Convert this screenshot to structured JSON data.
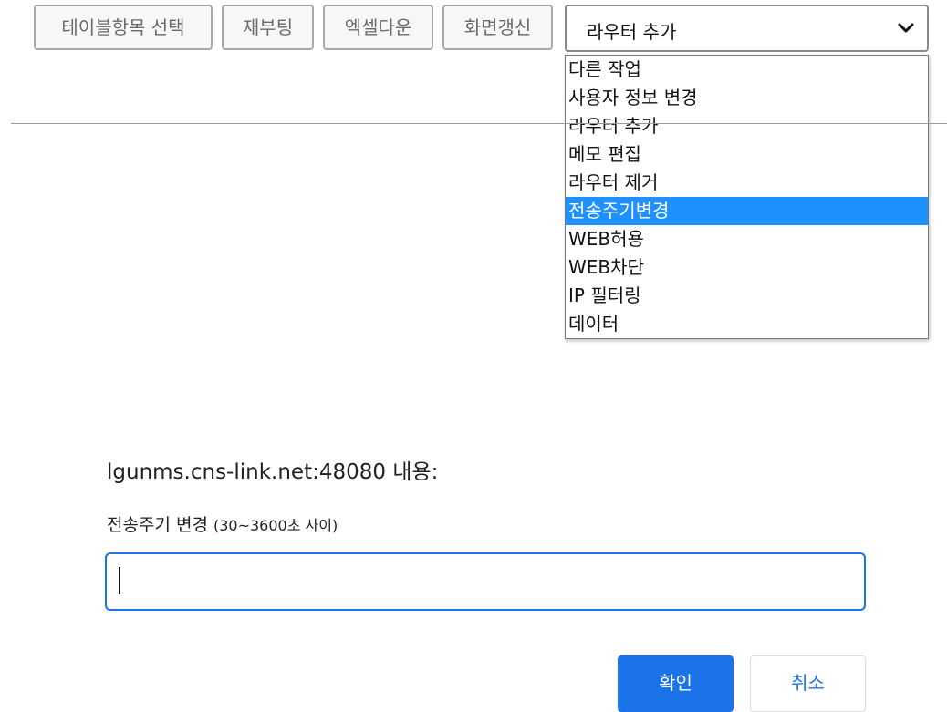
{
  "toolbar": {
    "buttons": [
      {
        "label": "테이블항목 선택"
      },
      {
        "label": "재부팅"
      },
      {
        "label": "엑셀다운"
      },
      {
        "label": "화면갱신"
      }
    ],
    "select": {
      "value": "라우터 추가",
      "options": [
        "다른 작업",
        "사용자 정보 변경",
        "라우터 추가",
        "메모 편집",
        "라우터 제거",
        "전송주기변경",
        "WEB허용",
        "WEB차단",
        "IP 필터링",
        "데이터"
      ],
      "highlighted": "전송주기변경"
    }
  },
  "dialog": {
    "host": "lgunms.cns-link.net:48080 내용:",
    "message": "전송주기 변경",
    "message_hint": "(30~3600초 사이)",
    "input_value": "",
    "ok_label": "확인",
    "cancel_label": "취소"
  },
  "colors": {
    "accent": "#1a73e8",
    "highlight": "#1e90ff"
  }
}
